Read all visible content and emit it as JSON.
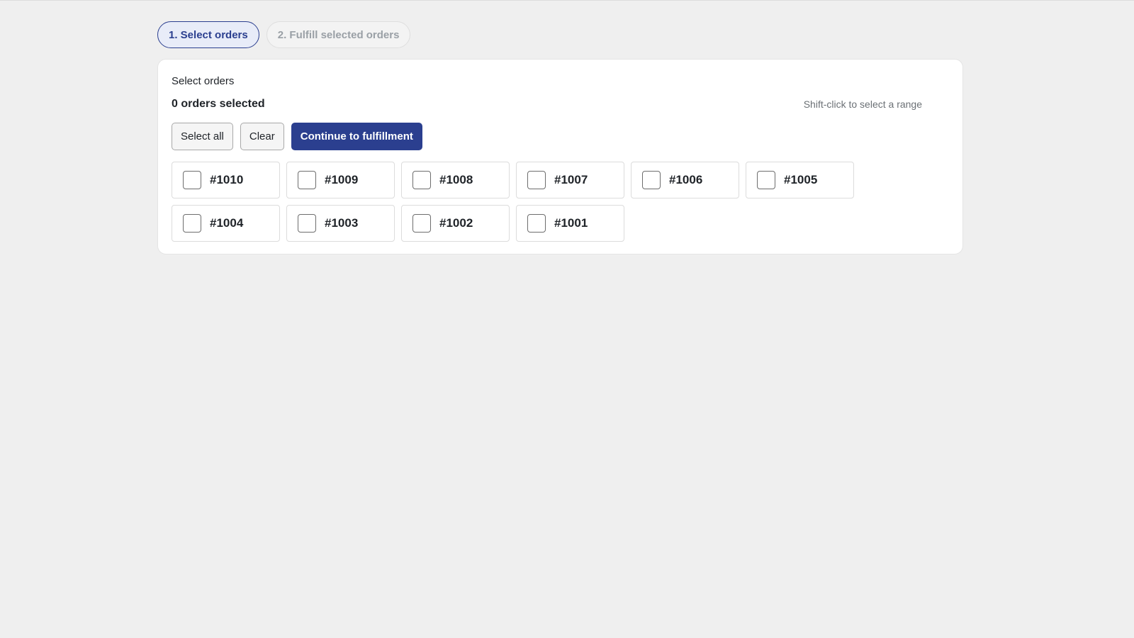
{
  "steps": [
    {
      "label": "1. Select orders",
      "active": true
    },
    {
      "label": "2. Fulfill selected orders",
      "active": false
    }
  ],
  "card": {
    "title": "Select orders",
    "selected_count": "0 orders selected",
    "hint": "Shift-click to select a range"
  },
  "actions": {
    "select_all": "Select all",
    "clear": "Clear",
    "continue": "Continue to fulfillment"
  },
  "orders": [
    {
      "id": "#1010",
      "checked": false
    },
    {
      "id": "#1009",
      "checked": false
    },
    {
      "id": "#1008",
      "checked": false
    },
    {
      "id": "#1007",
      "checked": false
    },
    {
      "id": "#1006",
      "checked": false
    },
    {
      "id": "#1005",
      "checked": false
    },
    {
      "id": "#1004",
      "checked": false
    },
    {
      "id": "#1003",
      "checked": false
    },
    {
      "id": "#1002",
      "checked": false
    },
    {
      "id": "#1001",
      "checked": false
    }
  ],
  "colors": {
    "accent": "#2b3f8f",
    "background": "#efefef",
    "card": "#ffffff"
  }
}
